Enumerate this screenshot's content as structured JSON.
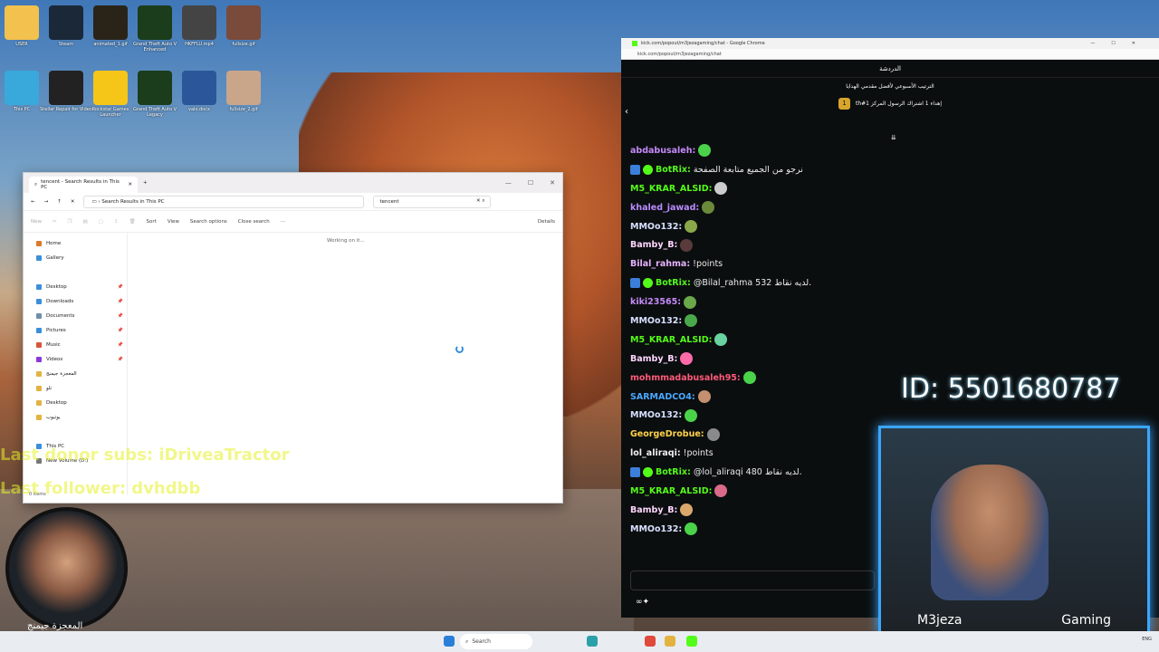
{
  "desktop": {
    "icons": [
      {
        "label": "USER",
        "icon": "folder-icon",
        "color": "#f2c14e"
      },
      {
        "label": "Steam",
        "icon": "steam-icon",
        "color": "#1b2838"
      },
      {
        "label": "animated_1.gif",
        "icon": "m3-logo-icon",
        "color": "#2a2418"
      },
      {
        "label": "Grand Theft Auto V Enhanced",
        "icon": "gta-icon",
        "color": "#1b3d1b"
      },
      {
        "label": "HKFFLU.mp4",
        "icon": "video-icon",
        "color": "#444444"
      },
      {
        "label": "fullsize.gif",
        "icon": "gif-icon",
        "color": "#7a4a3a"
      },
      {
        "label": "This PC",
        "icon": "pc-icon",
        "color": "#39a9dc"
      },
      {
        "label": "Stellar Repair for Video",
        "icon": "repair-icon",
        "color": "#222222"
      },
      {
        "label": "Rockstar Games Launcher",
        "icon": "rockstar-icon",
        "color": "#f5c518"
      },
      {
        "label": "Grand Theft Auto V Legacy",
        "icon": "gta-icon",
        "color": "#1b3d1b"
      },
      {
        "label": "valo.docx",
        "icon": "word-icon",
        "color": "#2b579a"
      },
      {
        "label": "fullsize_2.gif",
        "icon": "gif-icon",
        "color": "#c9a58a"
      }
    ]
  },
  "explorer": {
    "tab_title": "tencent - Search Results in This PC",
    "path": "Search Results in This PC",
    "search_value": "tencent",
    "toolbar": {
      "new": "New",
      "sort": "Sort",
      "view": "View",
      "search_options": "Search options",
      "close_search": "Close search",
      "more": "···",
      "details": "Details"
    },
    "nav": [
      {
        "label": "Home",
        "color": "#d97a2a"
      },
      {
        "label": "Gallery",
        "color": "#3a8fd9"
      },
      {
        "label": "Desktop",
        "color": "#3a8fd9"
      },
      {
        "label": "Downloads",
        "color": "#3a8fd9"
      },
      {
        "label": "Documents",
        "color": "#6f8fa8"
      },
      {
        "label": "Pictures",
        "color": "#3a8fd9"
      },
      {
        "label": "Music",
        "color": "#d9553a"
      },
      {
        "label": "Videos",
        "color": "#8a3ad9"
      },
      {
        "label": "المعجزة جيمنج",
        "color": "#e3b341"
      },
      {
        "label": "تلو",
        "color": "#e3b341"
      },
      {
        "label": "Desktop",
        "color": "#e3b341"
      },
      {
        "label": "يوتيوب",
        "color": "#e3b341"
      },
      {
        "label": "This PC",
        "color": "#3a8fd9"
      },
      {
        "label": "New Volume (D:)",
        "color": "#777777"
      }
    ],
    "working": "Working on it...",
    "status": "0 items"
  },
  "overlay": {
    "last_donor": "Last donor subs: iDriveaTractor",
    "last_follower": "Last follower: dvhdbb"
  },
  "chrome": {
    "title": "kick.com/popout/m3jezagaming/chat - Google Chrome",
    "url": "kick.com/popout/m3jezagaming/chat"
  },
  "chat": {
    "header": "الدردشة",
    "leaderboard": "الترتيب الأسبوعي لأفضل مقدمي الهدايا",
    "pinned": "th#إهداء 1 اشتراك الرسول المركز 1",
    "messages": [
      {
        "user": "abdabusaleh",
        "color": "#c58af9",
        "text": "",
        "emote": "#4ad24a",
        "bot": false
      },
      {
        "user": "BotRix",
        "color": "#53fc18",
        "text": "نرجو من الجميع متابعة الصفحة",
        "emote": "",
        "bot": true
      },
      {
        "user": "M5_KRAR_ALSID",
        "color": "#53fc18",
        "text": "",
        "emote": "#cccccc",
        "bot": false
      },
      {
        "user": "khaled_jawad",
        "color": "#b98cff",
        "text": "",
        "emote": "#6a8a3a",
        "bot": false
      },
      {
        "user": "MMOo132",
        "color": "#d7e0ff",
        "text": "",
        "emote": "#8aa84a",
        "bot": false
      },
      {
        "user": "Bamby_B",
        "color": "#ffd6ff",
        "text": "",
        "emote": "#5a3a3a",
        "bot": false
      },
      {
        "user": "Bilal_rahma",
        "color": "#e6b3ff",
        "text": "!points",
        "emote": "",
        "bot": false
      },
      {
        "user": "BotRix",
        "color": "#53fc18",
        "text": "@Bilal_rahma 532 لديه نقاط.",
        "emote": "",
        "bot": true
      },
      {
        "user": "kiki23565",
        "color": "#c58af9",
        "text": "",
        "emote": "#6aa84a",
        "bot": false
      },
      {
        "user": "MMOo132",
        "color": "#d7e0ff",
        "text": "",
        "emote": "#4aa84a",
        "bot": false
      },
      {
        "user": "M5_KRAR_ALSID",
        "color": "#53fc18",
        "text": "",
        "emote": "#6ad2a0",
        "bot": false
      },
      {
        "user": "Bamby_B",
        "color": "#ffd6ff",
        "text": "",
        "emote": "#ff6aa8",
        "bot": false
      },
      {
        "user": "mohmmadabusaleh95",
        "color": "#ff5a7a",
        "text": "",
        "emote": "#4ad24a",
        "bot": false
      },
      {
        "user": "SARMADCO4",
        "color": "#4aa8ff",
        "text": "",
        "emote": "#c49070",
        "bot": false
      },
      {
        "user": "MMOo132",
        "color": "#d7e0ff",
        "text": "",
        "emote": "#4ad24a",
        "bot": false
      },
      {
        "user": "GeorgeDrobue",
        "color": "#ffd34a",
        "text": "",
        "emote": "#8a8a8a",
        "bot": false
      },
      {
        "user": "lol_aliraqi",
        "color": "#f0f0f0",
        "text": "!points",
        "emote": "",
        "bot": false
      },
      {
        "user": "BotRix",
        "color": "#53fc18",
        "text": "@lol_aliraqi 480 لديه نقاط.",
        "emote": "",
        "bot": true
      },
      {
        "user": "M5_KRAR_ALSID",
        "color": "#53fc18",
        "text": "",
        "emote": "#d96a8a",
        "bot": false
      },
      {
        "user": "Bamby_B",
        "color": "#ffd6ff",
        "text": "",
        "emote": "#d9a86a",
        "bot": false
      },
      {
        "user": "MMOo132",
        "color": "#d7e0ff",
        "text": "",
        "emote": "#4ad24a",
        "bot": false
      }
    ]
  },
  "stream": {
    "id_text": "ID: 5501680787",
    "cam_left": "M3jeza",
    "cam_right": "Gaming",
    "avatar_name": "المعجزة جيمنج"
  },
  "taskbar": {
    "search": "Search",
    "lang": "ENG"
  }
}
